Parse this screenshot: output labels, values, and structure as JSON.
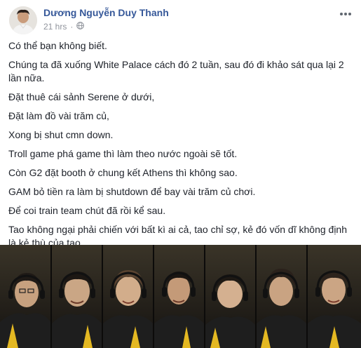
{
  "post": {
    "author": "Dương Nguyễn Duy Thanh",
    "time": "21 hrs",
    "privacy_icon": "globe-icon",
    "more_icon": "more-options-icon",
    "paragraphs": [
      "Có thể bạn không biết.",
      "Chúng ta đã xuống White Palace cách đó 2 tuần, sau đó đi khảo sát qua lại 2 lần nữa.",
      "Đặt thuê cái sảnh Serene ở dưới,",
      "Đặt làm đồ vài trăm củ,",
      "Xong bị shut cmn down.",
      "Troll game phá game thì làm theo nước ngoài sẽ tốt.",
      "Còn G2 đặt booth ở chung kết Athens thì không sao.",
      "GAM bỏ tiền ra làm bị shutdown để bay vài trăm củ chơi.",
      "Để coi train team chút đã rồi kể sau.",
      "Tao không ngại phải chiến với bất kì ai cả, tao chỉ sợ, kẻ đó vốn dĩ không định là kẻ thù của tao."
    ]
  },
  "photo": {
    "team_members": 7,
    "jersey_color": "#1e1e1e",
    "accent_color": "#e4b822"
  },
  "colors": {
    "author_link": "#365899",
    "meta_text": "#90949c",
    "body_text": "#1d2129"
  }
}
